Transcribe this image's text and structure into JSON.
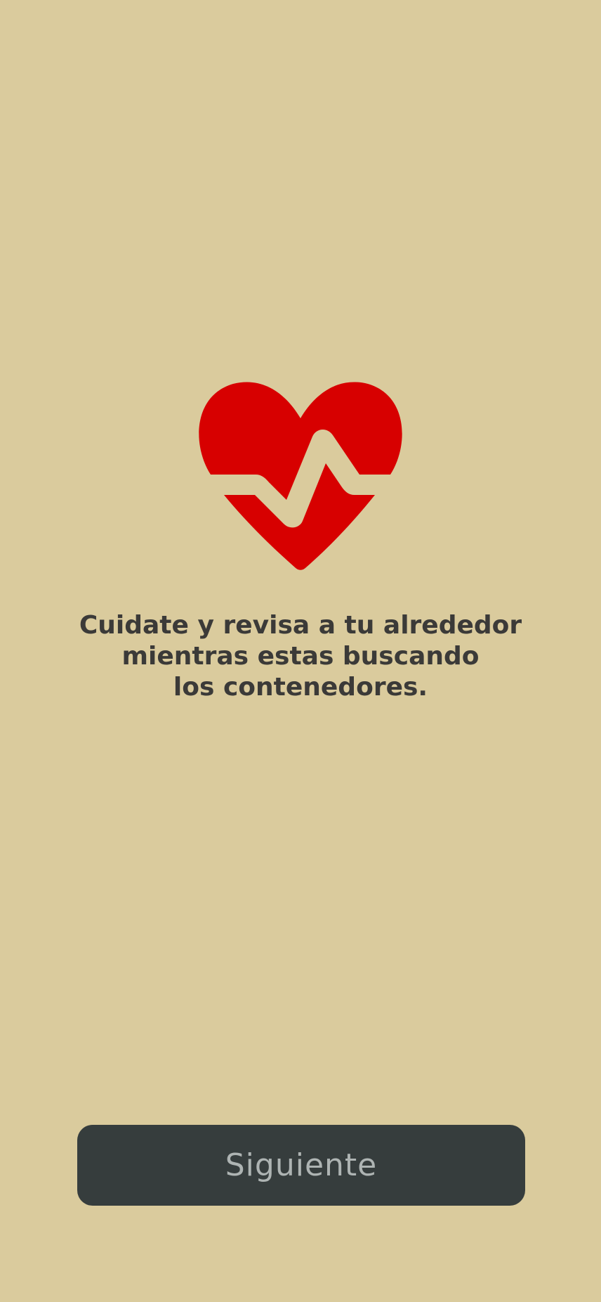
{
  "theme": {
    "background": "#DACB9D",
    "heart_color": "#D70000",
    "text_color": "#3B3A38",
    "button_background": "#363D3D",
    "button_text": "#AEB4B3"
  },
  "illustration": {
    "icon": "heart-pulse-icon"
  },
  "message": {
    "line1": "Cuidate y revisa a tu alrededor",
    "line2": "mientras estas buscando",
    "line3": "los contenedores."
  },
  "actions": {
    "next_label": "Siguiente"
  }
}
